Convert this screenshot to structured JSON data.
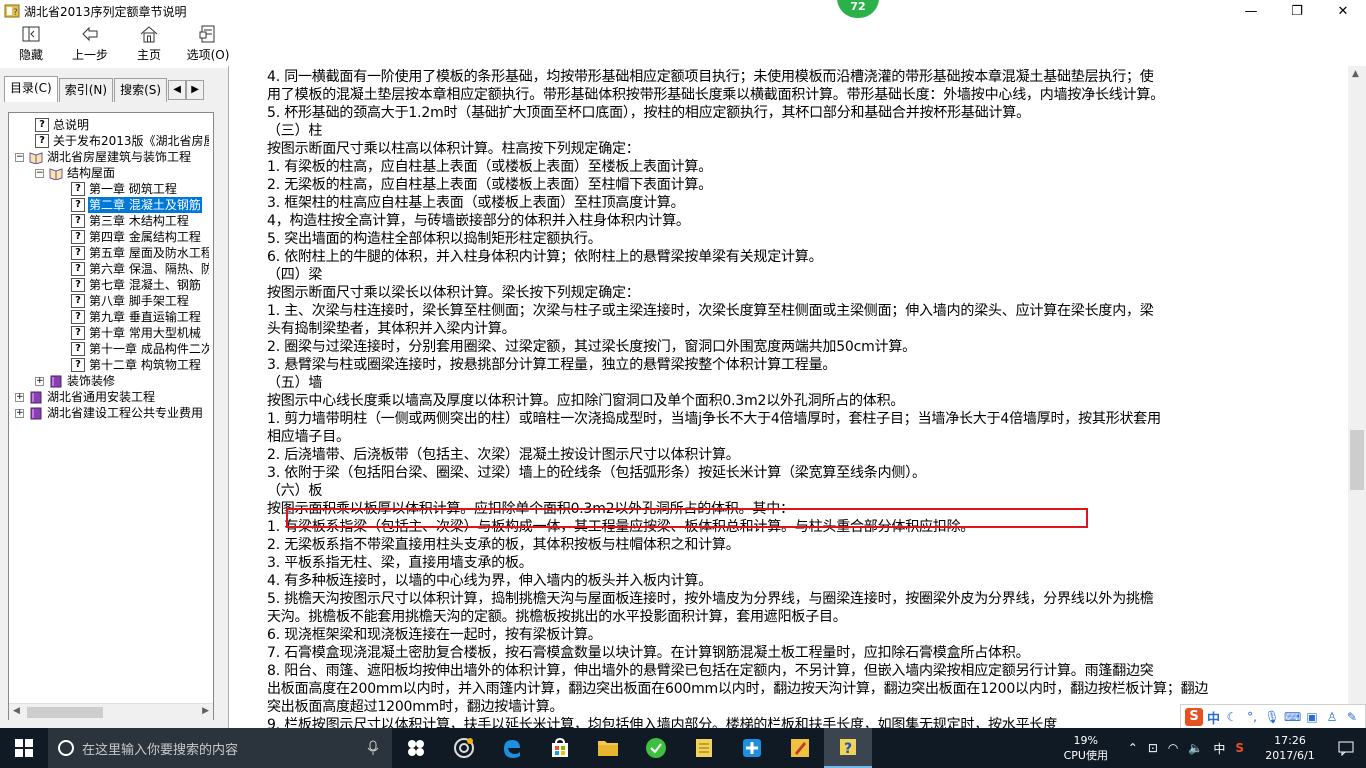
{
  "window": {
    "title": "湖北省2013序列定额章节说明",
    "badge": "72"
  },
  "toolbar": {
    "buttons": [
      {
        "label": "隐藏",
        "icon": "hide-icon"
      },
      {
        "label": "上一步",
        "icon": "back-arrow-icon"
      },
      {
        "label": "主页",
        "icon": "home-icon"
      },
      {
        "label": "选项(O)",
        "icon": "options-icon"
      }
    ]
  },
  "tabs": [
    {
      "label": "目录(C)"
    },
    {
      "label": "索引(N)"
    },
    {
      "label": "搜索(S)"
    }
  ],
  "tree": [
    {
      "label": "总说明",
      "indent": 1,
      "type": "doc"
    },
    {
      "label": "关于发布2013版《湖北省房屋",
      "indent": 1,
      "type": "doc"
    },
    {
      "label": "湖北省房屋建筑与装饰工程",
      "indent": 0,
      "type": "book-open",
      "exp": "−"
    },
    {
      "label": "结构屋面",
      "indent": 1,
      "type": "book-open",
      "exp": "−"
    },
    {
      "label": "第一章 砌筑工程",
      "indent": 3,
      "type": "doc"
    },
    {
      "label": "第二章 混凝土及钢筋",
      "indent": 3,
      "type": "doc",
      "selected": true
    },
    {
      "label": "第三章 木结构工程",
      "indent": 3,
      "type": "doc"
    },
    {
      "label": "第四章 金属结构工程",
      "indent": 3,
      "type": "doc"
    },
    {
      "label": "第五章 屋面及防水工程",
      "indent": 3,
      "type": "doc"
    },
    {
      "label": "第六章 保温、隔热、防",
      "indent": 3,
      "type": "doc"
    },
    {
      "label": "第七章 混凝土、钢筋",
      "indent": 3,
      "type": "doc"
    },
    {
      "label": "第八章 脚手架工程",
      "indent": 3,
      "type": "doc"
    },
    {
      "label": "第九章 垂直运输工程",
      "indent": 3,
      "type": "doc"
    },
    {
      "label": "第十章 常用大型机械",
      "indent": 3,
      "type": "doc"
    },
    {
      "label": "第十一章 成品构件二次",
      "indent": 3,
      "type": "doc"
    },
    {
      "label": "第十二章 构筑物工程",
      "indent": 3,
      "type": "doc"
    },
    {
      "label": "装饰装修",
      "indent": 1,
      "type": "book",
      "exp": "+"
    },
    {
      "label": "湖北省通用安装工程",
      "indent": 0,
      "type": "book",
      "exp": "+"
    },
    {
      "label": "湖北省建设工程公共专业费用",
      "indent": 0,
      "type": "book",
      "exp": "+"
    }
  ],
  "content_lines": [
    "4. 同一横截面有一阶使用了模板的条形基础，均按带形基础相应定额项目执行；未使用模板而沿槽浇灌的带形基础按本章混凝土基础垫层执行；使",
    "用了模板的混凝土垫层按本章相应定额执行。带形基础体积按带形基础长度乘以横截面积计算。带形基础长度：外墙按中心线，内墙按净长线计算。",
    "5. 杯形基础的颈高大于1.2m时（基础扩大顶面至杯口底面），按柱的相应定额执行，其杯口部分和基础合并按杯形基础计算。",
    "（三）柱",
    "按图示断面尺寸乘以柱高以体积计算。柱高按下列规定确定：",
    "1. 有梁板的柱高，应自柱基上表面（或楼板上表面）至楼板上表面计算。",
    "2. 无梁板的柱高，应自柱基上表面（或楼板上表面）至柱帽下表面计算。",
    "3. 框架柱的柱高应自柱基上表面（或楼板上表面）至柱顶高度计算。",
    "4，构造柱按全高计算，与砖墙嵌接部分的体积并入柱身体积内计算。",
    "5. 突出墙面的构造柱全部体积以捣制矩形柱定额执行。",
    "6. 依附柱上的牛腿的体积，并入柱身体积内计算；依附柱上的悬臂梁按单梁有关规定计算。",
    "（四）梁",
    "按图示断面尺寸乘以梁长以体积计算。梁长按下列规定确定：",
    "1. 主、次梁与柱连接时，梁长算至柱侧面；次梁与柱子或主梁连接时，次梁长度算至柱侧面或主梁侧面；伸入墙内的梁头、应计算在梁长度内，梁",
    "头有捣制梁垫者，其体积并入梁内计算。",
    "2. 圈梁与过梁连接时，分别套用圈梁、过梁定额，其过梁长度按门，窗洞口外围宽度两端共加50cm计算。",
    "3. 悬臂梁与柱或圈梁连接时，按悬挑部分计算工程量，独立的悬臂梁按整个体积计算工程量。",
    "（五）墙",
    "按图示中心线长度乘以墙高及厚度以体积计算。应扣除门窗洞口及单个面积0.3m2以外孔洞所占的体积。",
    "1. 剪力墙带明柱（一侧或两侧突出的柱）或暗柱一次浇捣成型时，当墙j争长不大于4倍墙厚时，套柱子目；当墙净长大于4倍墙厚时，按其形状套用",
    "相应墙子目。",
    "2. 后浇墙带、后浇板带（包括主、次梁）混凝土按设计图示尺寸以体积计算。",
    "3. 依附于梁（包括阳台梁、圈梁、过梁）墙上的砼线条（包括弧形条）按延长米计算（梁宽算至线条内侧）。",
    "（六）板",
    "按图示面积乘以板厚以体积计算。应扣除单个面积0.3m2以外孔洞所占的体积。其中：",
    "1. 有梁板系指梁（包括主、次梁）与板构成一体，其工程量应按梁、板体积总和计算。与柱头重合部分体积应扣除。",
    "2. 无梁板系指不带梁直接用柱头支承的板，其体积按板与柱帽体积之和计算。",
    "3. 平板系指无柱、梁，直接用墙支承的板。",
    "4. 有多种板连接时，以墙的中心线为界，伸入墙内的板头并入板内计算。",
    "5. 挑檐天沟按图示尺寸以体积计算，捣制挑檐天沟与屋面板连接时，按外墙皮为分界线，与圈梁连接时，按圈梁外皮为分界线，分界线以外为挑檐",
    "天沟。挑檐板不能套用挑檐天沟的定额。挑檐板按挑出的水平投影面积计算，套用遮阳板子目。",
    "6. 现浇框架梁和现浇板连接在一起时，按有梁板计算。",
    "7. 石膏模盒现浇混凝土密肋复合楼板，按石膏模盒数量以块计算。在计算钢筋混凝土板工程量时，应扣除石膏模盒所占体积。",
    "8. 阳台、雨篷、遮阳板均按伸出墙外的体积计算，伸出墙外的悬臂梁已包括在定额内，不另计算，但嵌入墙内梁按相应定额另行计算。雨篷翻边突",
    "出板面高度在200mm以内时，并入雨篷内计算，翻边突出板面在600mm以内时，翻边按天沟计算，翻边突出板面在1200以内时，翻边按栏板计算；翻边",
    "突出板面高度超过1200mm时，翻边按墙计算。",
    "9. 栏板按图示尺寸以体积计算，扶手以延长米计算，均包括伸入墙内部分。楼梯的栏板和扶手长度，如图集无规定时，按水平长度"
  ],
  "taskbar": {
    "search_placeholder": "在这里输入你要搜索的内容",
    "cpu_percent": "19%",
    "cpu_label": "CPU使用",
    "time": "17:26",
    "date": "2017/6/1",
    "ime_lang": "中"
  },
  "ime_bar": {
    "logo": "S",
    "lang": "中"
  },
  "colors": {
    "selection": "#0078d7",
    "highlight_box": "#e0141b",
    "badge": "#2bb04a",
    "taskbar": "#101a24"
  }
}
